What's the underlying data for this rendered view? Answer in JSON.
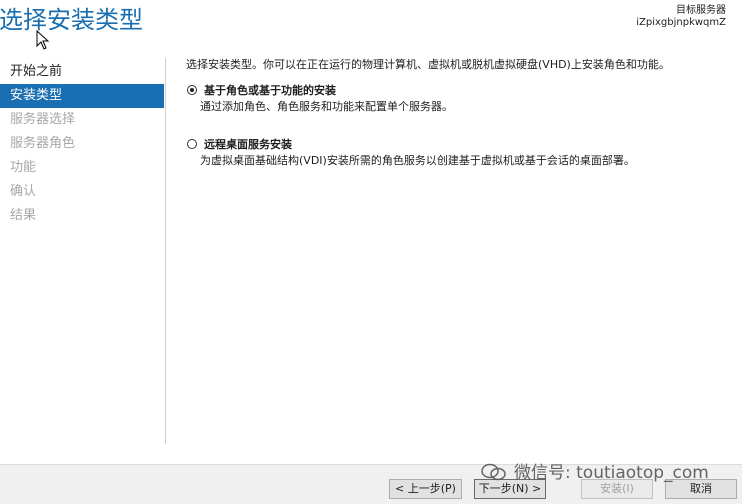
{
  "page_title": "选择安装类型",
  "server": {
    "label": "目标服务器",
    "name": "iZpixgbjnpkwqmZ"
  },
  "sidebar": {
    "items": [
      {
        "label": "开始之前",
        "state": "normal"
      },
      {
        "label": "安装类型",
        "state": "active"
      },
      {
        "label": "服务器选择",
        "state": "disabled"
      },
      {
        "label": "服务器角色",
        "state": "disabled"
      },
      {
        "label": "功能",
        "state": "disabled"
      },
      {
        "label": "确认",
        "state": "disabled"
      },
      {
        "label": "结果",
        "state": "disabled"
      }
    ]
  },
  "main": {
    "intro": "选择安装类型。你可以在正在运行的物理计算机、虚拟机或脱机虚拟硬盘(VHD)上安装角色和功能。",
    "options": [
      {
        "title": "基于角色或基于功能的安装",
        "description": "通过添加角色、角色服务和功能来配置单个服务器。",
        "selected": true
      },
      {
        "title": "远程桌面服务安装",
        "description": "为虚拟桌面基础结构(VDI)安装所需的角色服务以创建基于虚拟机或基于会话的桌面部署。",
        "selected": false
      }
    ]
  },
  "footer": {
    "prev_label": "< 上一步(P)",
    "next_label": "下一步(N) >",
    "install_label": "安装(I)",
    "cancel_label": "取消"
  },
  "watermark": "微信号: toutiaotop_com",
  "colors": {
    "accent": "#1a6fb2",
    "title": "#1b6fb0",
    "disabled_text": "#a8a8a8"
  }
}
